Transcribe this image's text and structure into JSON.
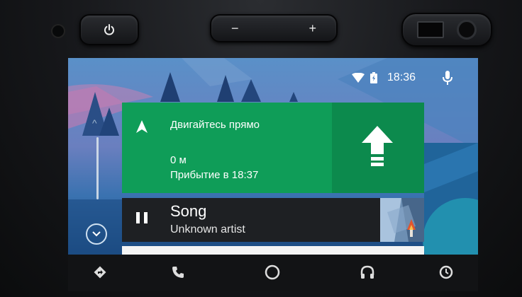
{
  "hardware": {
    "power_icon": "power-icon",
    "vol_minus": "−",
    "vol_plus": "+"
  },
  "status_bar": {
    "time": "18:36",
    "wifi_icon": "wifi-icon",
    "battery_icon": "battery-icon",
    "mic_icon": "mic-icon"
  },
  "navigation": {
    "instruction": "Двигайтесь прямо",
    "distance": "0 м",
    "arrival": "Прибытие в 18:37",
    "turn_icon": "arrow-up-icon"
  },
  "media": {
    "title": "Song",
    "artist": "Unknown artist",
    "state_icon": "pause-icon"
  },
  "bottom_nav": [
    {
      "icon": "directions-icon"
    },
    {
      "icon": "phone-icon"
    },
    {
      "icon": "home-icon"
    },
    {
      "icon": "headphones-icon"
    },
    {
      "icon": "exit-icon"
    }
  ],
  "colors": {
    "nav_green": "#0f9d58",
    "nav_green_dark": "#0c8a4d",
    "media_bg": "#1e2023"
  }
}
